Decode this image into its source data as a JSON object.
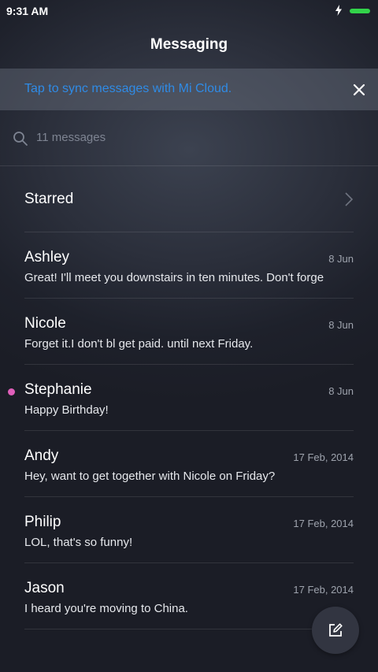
{
  "status_bar": {
    "time": "9:31 AM",
    "icons": [
      "charging-bolt-icon",
      "battery-icon"
    ],
    "battery_color": "#32d34a"
  },
  "header": {
    "title": "Messaging"
  },
  "sync_banner": {
    "text": "Tap to sync messages with Mi Cloud.",
    "text_color": "#2f8be6",
    "close_icon": "close-icon"
  },
  "search": {
    "placeholder": "11 messages",
    "icon": "search-icon"
  },
  "starred": {
    "label": "Starred",
    "icon": "chevron-right-icon"
  },
  "threads": [
    {
      "name": "Ashley",
      "date": "8 Jun",
      "snippet": "Great! I'll meet you downstairs in ten minutes. Don't forge",
      "unread": false
    },
    {
      "name": "Nicole",
      "date": "8 Jun",
      "snippet": "Forget it.I don't bl get paid. until next Friday.",
      "unread": false
    },
    {
      "name": "Stephanie",
      "date": "8 Jun",
      "snippet": "Happy Birthday!",
      "unread": true
    },
    {
      "name": "Andy",
      "date": "17 Feb, 2014",
      "snippet": "Hey, want to get together with Nicole on Friday?",
      "unread": false
    },
    {
      "name": "Philip",
      "date": "17 Feb, 2014",
      "snippet": "LOL, that's so funny!",
      "unread": false
    },
    {
      "name": "Jason",
      "date": "17 Feb, 2014",
      "snippet": "I heard you're moving to China.",
      "unread": false
    }
  ],
  "unread_dot_color": "#e05fba",
  "compose": {
    "icon": "compose-icon"
  }
}
